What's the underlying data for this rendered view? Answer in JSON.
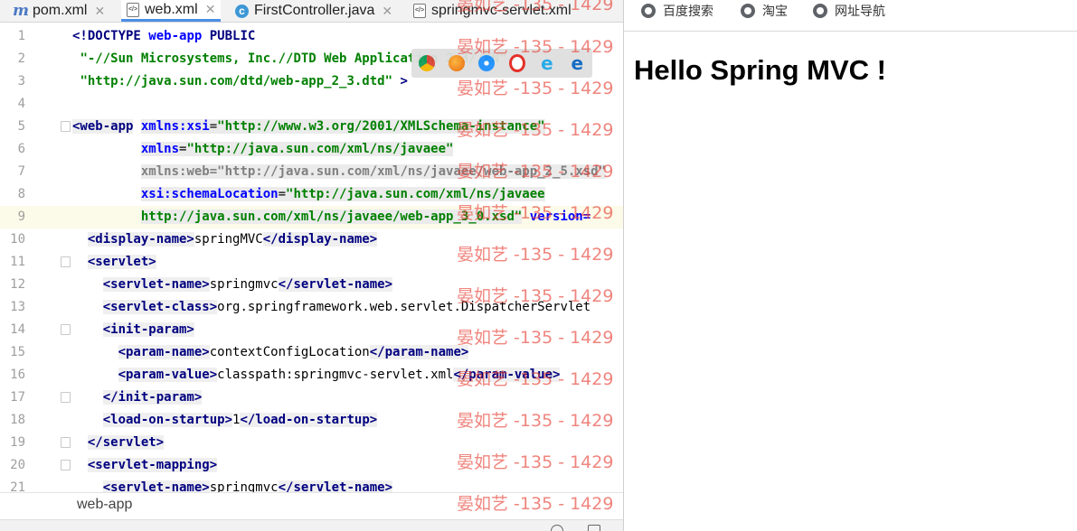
{
  "ide": {
    "tabs": [
      {
        "label": "pom.xml",
        "icon": "maven-m-icon",
        "active": false
      },
      {
        "label": "web.xml",
        "icon": "xml-file-icon",
        "active": true
      },
      {
        "label": "FirstController.java",
        "icon": "java-class-icon",
        "active": false
      },
      {
        "label": "springmvc-servlet.xml",
        "icon": "xml-file-icon",
        "active": false
      }
    ],
    "lines": [
      {
        "n": "1"
      },
      {
        "n": "2"
      },
      {
        "n": "3"
      },
      {
        "n": "4"
      },
      {
        "n": "5"
      },
      {
        "n": "6"
      },
      {
        "n": "7"
      },
      {
        "n": "8"
      },
      {
        "n": "9"
      },
      {
        "n": "10"
      },
      {
        "n": "11"
      },
      {
        "n": "12"
      },
      {
        "n": "13"
      },
      {
        "n": "14"
      },
      {
        "n": "15"
      },
      {
        "n": "16"
      },
      {
        "n": "17"
      },
      {
        "n": "18"
      },
      {
        "n": "19"
      },
      {
        "n": "20"
      },
      {
        "n": "21"
      }
    ],
    "code": {
      "l1_doctype": "<!DOCTYPE",
      "l1_root": "web-app",
      "l1_public": "PUBLIC",
      "l2_public_id": "\"-//Sun Microsystems, Inc.//DTD Web Application 2.3//EN\"",
      "l3_system_id": "\"http://java.sun.com/dtd/web-app_2_3.dtd\"",
      "l3_close": " >",
      "l5_open": "<web-app",
      "l5_attr": "xmlns:xsi",
      "l5_val": "\"http://www.w3.org/2001/XMLSchema-instance\"",
      "l6_attr": "xmlns",
      "l6_val": "\"http://java.sun.com/xml/ns/javaee\"",
      "l7_attr": "xmlns:web",
      "l7_val": "\"http://java.sun.com/xml/ns/javaee/web-app_2_5.xsd\"",
      "l8_attr": "xsi:schemaLocation",
      "l8_val": "\"http://java.sun.com/xml/ns/javaee",
      "l9_val": "http://java.sun.com/xml/ns/javaee/web-app_3_0.xsd\"",
      "l9_attr": "version=",
      "l10_open": "<display-name>",
      "l10_text": "springMVC",
      "l10_close": "</display-name>",
      "l11_open": "<servlet>",
      "l12_open": "<servlet-name>",
      "l12_text": "springmvc",
      "l12_close": "</servlet-name>",
      "l13_open": "<servlet-class>",
      "l13_text": "org.springframework.web.servlet.DispatcherServlet",
      "l14_open": "<init-param>",
      "l15_open": "<param-name>",
      "l15_text": "contextConfigLocation",
      "l15_close": "</param-name>",
      "l16_open": "<param-value>",
      "l16_text": "classpath:springmvc-servlet.xml",
      "l16_close": "</param-value>",
      "l17_close": "</init-param>",
      "l18_open": "<load-on-startup>",
      "l18_text": "1",
      "l18_close": "</load-on-startup>",
      "l19_close": "</servlet>",
      "l20_open": "<servlet-mapping>",
      "l21_open": "<servlet-name>",
      "l21_text": "springmvc",
      "l21_close": "</servlet-name>"
    },
    "breadcrumb": "web-app",
    "browser_icons": [
      "chrome-icon",
      "firefox-icon",
      "safari-icon",
      "opera-icon",
      "ie-icon",
      "edge-icon"
    ]
  },
  "browser": {
    "bookmarks": [
      {
        "label": "百度搜索",
        "icon": "globe-icon"
      },
      {
        "label": "淘宝",
        "icon": "globe-icon"
      },
      {
        "label": "网址导航",
        "icon": "globe-icon"
      }
    ],
    "heading": "Hello Spring MVC !"
  },
  "watermark": "晏如艺 -135 - 1429",
  "colors": {
    "tag": "#000080",
    "attr_name": "#0000ff",
    "attr_value": "#008000",
    "current_line": "#fcfae8",
    "watermark": "#e8443a",
    "active_tab_underline": "#4a8fe7"
  }
}
